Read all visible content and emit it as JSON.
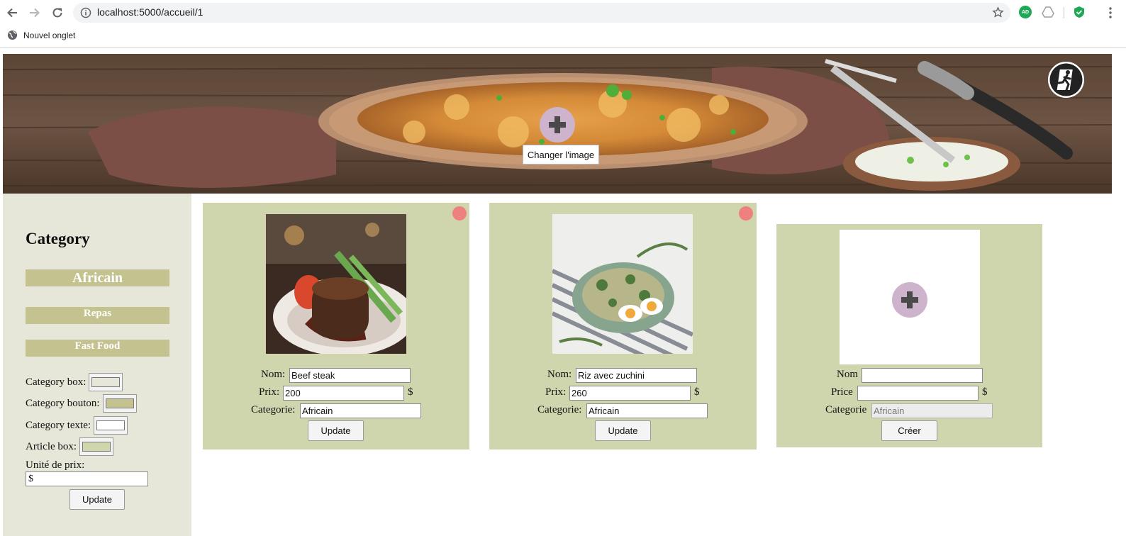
{
  "browser": {
    "url": "localhost:5000/accueil/1",
    "bookmark_label": "Nouvel onglet",
    "extension_badge": "AD"
  },
  "banner": {
    "change_image_label": "Changer l'image"
  },
  "sidebar": {
    "title": "Category",
    "categories": [
      "Africain",
      "Repas",
      "Fast Food"
    ],
    "settings": {
      "category_box_label": "Category box:",
      "category_button_label": "Category bouton:",
      "category_text_label": "Category texte:",
      "article_box_label": "Article box:",
      "price_unit_label": "Unité de prix:",
      "price_unit_value": "$",
      "update_label": "Update"
    },
    "colors": {
      "category_box": "#e6e6d9",
      "category_button": "#c4c28f",
      "category_text": "#ffffff",
      "article_box": "#cfd6ae"
    }
  },
  "articles": [
    {
      "name_label": "Nom:",
      "name_value": "Beef steak",
      "price_label": "Prix:",
      "price_value": "200",
      "unit": "$",
      "category_label": "Categorie:",
      "category_value": "Africain",
      "button_label": "Update"
    },
    {
      "name_label": "Nom:",
      "name_value": "Riz avec zuchini",
      "price_label": "Prix:",
      "price_value": "260",
      "unit": "$",
      "category_label": "Categorie:",
      "category_value": "Africain",
      "button_label": "Update"
    }
  ],
  "new_article": {
    "name_label": "Nom",
    "name_value": "",
    "price_label": "Price",
    "price_value": "",
    "unit": "$",
    "category_label": "Categorie",
    "category_value": "Africain",
    "button_label": "Créer"
  }
}
